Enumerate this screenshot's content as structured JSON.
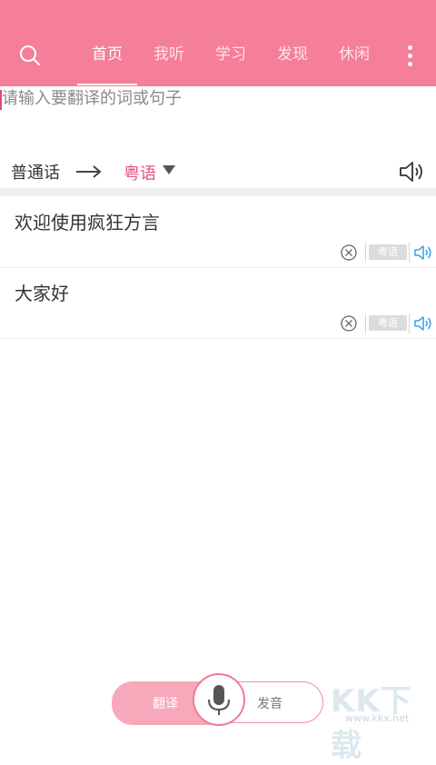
{
  "header": {
    "tabs": [
      {
        "label": "首页",
        "active": true
      },
      {
        "label": "我听",
        "active": false
      },
      {
        "label": "学习",
        "active": false
      },
      {
        "label": "发现",
        "active": false
      },
      {
        "label": "休闲",
        "active": false
      }
    ]
  },
  "input": {
    "placeholder": "请输入要翻译的词或句子"
  },
  "language": {
    "from": "普通话",
    "to": "粤语"
  },
  "history": [
    {
      "text": "欢迎使用疯狂方言",
      "badge": "粤语"
    },
    {
      "text": "大家好",
      "badge": "粤语"
    }
  ],
  "bottom": {
    "translate_label": "翻译",
    "pronounce_label": "发音"
  },
  "watermark": {
    "logo": "KK下载",
    "url": "www.kkx.net"
  },
  "colors": {
    "brand": "#f57e98",
    "accent": "#e94d82",
    "speaker": "#3aa0e0"
  }
}
